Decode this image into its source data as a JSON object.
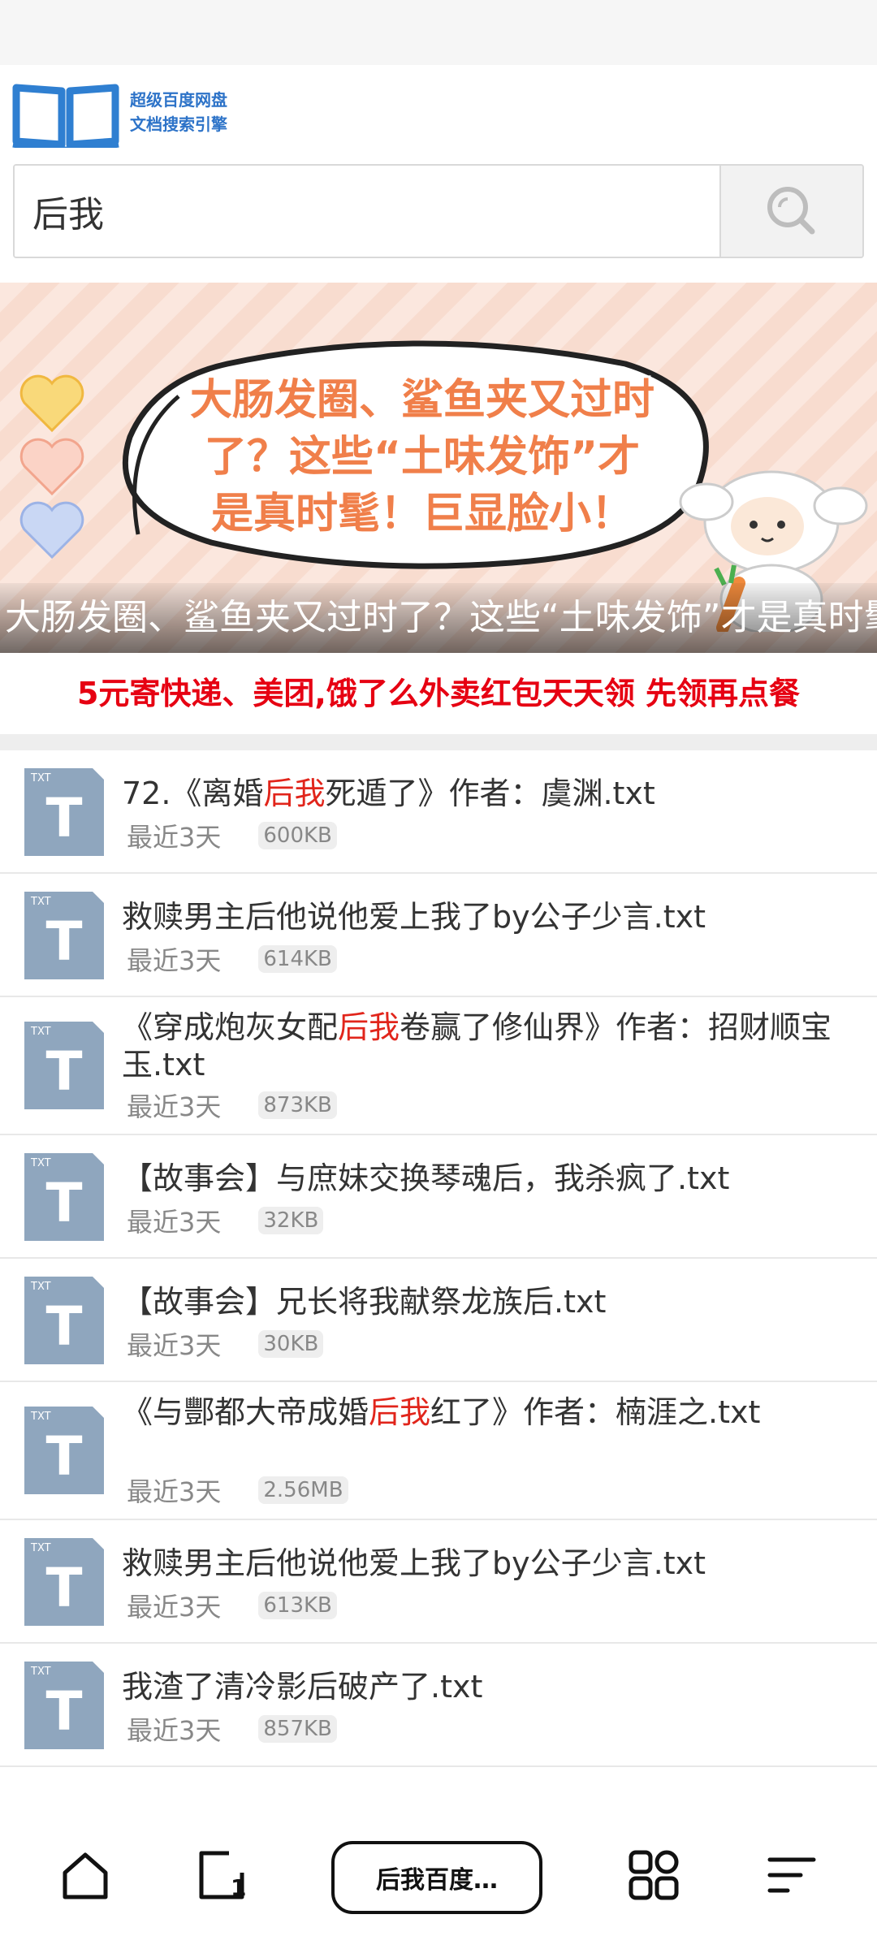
{
  "header": {
    "logo_line1": "超级百度网盘",
    "logo_line2": "文档搜索引擎",
    "logo_icon": "open-book-icon"
  },
  "search": {
    "value": "后我",
    "button_icon": "search-icon"
  },
  "banner": {
    "headline_line1": "大肠发圈、鲨鱼夹又过时",
    "headline_line2": "了？这些“土味发饰”才",
    "headline_line3": "是真时髦！巨显脸小！",
    "caption": "大肠发圈、鲨鱼夹又过时了？这些“土味发饰”才是真时髦！巨显脸小！"
  },
  "promo": {
    "text": "5元寄快递、美团,饿了么外卖红包天天领 先领再点餐",
    "color": "#e60012"
  },
  "results": [
    {
      "title_pre": "72.《离婚",
      "title_hl": "后我",
      "title_post": "死遁了》作者：虞渊.txt",
      "date": "最近3天",
      "size": "600KB"
    },
    {
      "title_pre": "救赎男主后他说他爱上我了by公子少言.txt",
      "title_hl": "",
      "title_post": "",
      "date": "最近3天",
      "size": "614KB"
    },
    {
      "title_pre": "《穿成炮灰女配",
      "title_hl": "后我",
      "title_post": "卷赢了修仙界》作者：招财顺宝玉.txt",
      "date": "最近3天",
      "size": "873KB"
    },
    {
      "title_pre": "【故事会】与庶妹交换琴魂后，我杀疯了.txt",
      "title_hl": "",
      "title_post": "",
      "date": "最近3天",
      "size": "32KB"
    },
    {
      "title_pre": "【故事会】兄长将我献祭龙族后.txt",
      "title_hl": "",
      "title_post": "",
      "date": "最近3天",
      "size": "30KB"
    },
    {
      "title_pre": "《与酆都大帝成婚",
      "title_hl": "后我",
      "title_post": "红了》作者：楠涯之.txt",
      "date": "最近3天",
      "size": "2.56MB"
    },
    {
      "title_pre": "救赎男主后他说他爱上我了by公子少言.txt",
      "title_hl": "",
      "title_post": "",
      "date": "最近3天",
      "size": "613KB"
    },
    {
      "title_pre": "我渣了清冷影后破产了.txt",
      "title_hl": "",
      "title_post": "",
      "date": "最近3天",
      "size": "857KB"
    }
  ],
  "file_icon_label": "TXT",
  "file_icon_letter": "T",
  "bottom_nav": {
    "home_icon": "home-icon",
    "tabs_icon": "tabs-icon",
    "tabs_count": "1",
    "url_pill": "后我百度…",
    "apps_icon": "apps-grid-icon",
    "menu_icon": "menu-icon"
  }
}
